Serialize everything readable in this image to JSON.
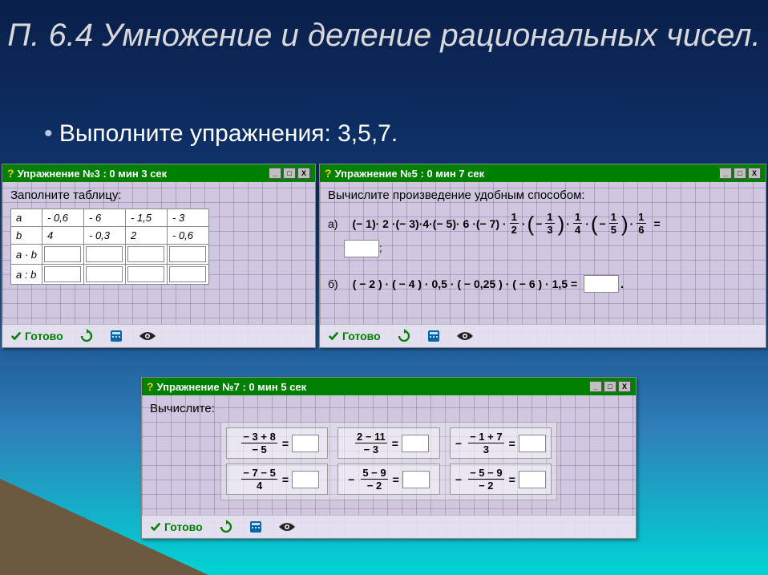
{
  "slide": {
    "title": "П. 6.4 Умножение и деление рациональных чисел.",
    "subtitle": "Выполните упражнения: 3,5,7."
  },
  "common": {
    "ready": "Готово",
    "btn_min": "_",
    "btn_max": "□",
    "btn_close": "X",
    "q": "?"
  },
  "ex3": {
    "title": "Упражнение №3 : 0 мин  3 сек",
    "instr": "Заполните таблицу:",
    "rows": {
      "r1": {
        "lbl": "a",
        "c1": "- 0,6",
        "c2": "- 6",
        "c3": "- 1,5",
        "c4": "- 3"
      },
      "r2": {
        "lbl": "b",
        "c1": "4",
        "c2": "- 0,3",
        "c3": "2",
        "c4": "- 0,6"
      },
      "r3": {
        "lbl": "a · b"
      },
      "r4": {
        "lbl": "a : b"
      }
    }
  },
  "ex5": {
    "title": "Упражнение №5 : 0 мин  7 сек",
    "instr": "Вычислите произведение удобным способом:",
    "a_label": "а)",
    "b_label": "б)",
    "a_parts": {
      "p1": "(− 1)· 2 ·(− 3)·4·(− 5)· 6 ·(− 7) ·",
      "eq": "="
    },
    "a_fracs": {
      "f1": {
        "n": "1",
        "d": "2"
      },
      "f2": {
        "n": "1",
        "d": "3"
      },
      "f3": {
        "n": "1",
        "d": "4"
      },
      "f4": {
        "n": "1",
        "d": "5"
      },
      "f5": {
        "n": "1",
        "d": "6"
      }
    },
    "b_expr": "( − 2 ) · ( − 4 ) · 0,5 · ( − 0,25 ) · ( − 6 ) · 1,5 ="
  },
  "ex7": {
    "title": "Упражнение №7 : 0 мин  5 сек",
    "instr": "Вычислите:",
    "cells": {
      "c1": {
        "neg": "",
        "n": "− 3 + 8",
        "d": "− 5"
      },
      "c2": {
        "neg": "",
        "n": "2 − 11",
        "d": "− 3"
      },
      "c3": {
        "neg": "−",
        "n": "− 1 + 7",
        "d": "3"
      },
      "c4": {
        "neg": "",
        "n": "− 7 − 5",
        "d": "4"
      },
      "c5": {
        "neg": "−",
        "n": "5 − 9",
        "d": "− 2"
      },
      "c6": {
        "neg": "−",
        "n": "− 5 − 9",
        "d": "− 2"
      }
    },
    "eq": "="
  }
}
